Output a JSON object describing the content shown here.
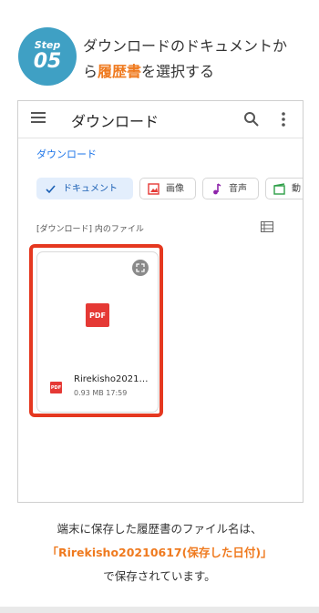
{
  "step": {
    "word": "Step",
    "number": "05"
  },
  "title": {
    "line1": "ダウンロードのドキュメントか",
    "line2_pre": "ら",
    "line2_highlight": "履歴書",
    "line2_post": "を選択する"
  },
  "appbar": {
    "title": "ダウンロード",
    "icons": [
      "menu-icon",
      "search-icon",
      "more-vert-icon"
    ]
  },
  "breadcrumb": "ダウンロード",
  "chips": [
    {
      "label": "ドキュメント",
      "icon": "check-icon",
      "active": true
    },
    {
      "label": "画像",
      "icon": "image-icon",
      "active": false
    },
    {
      "label": "音声",
      "icon": "music-note-icon",
      "active": false
    },
    {
      "label": "動",
      "icon": "video-icon",
      "active": false
    }
  ],
  "section_label": "[ダウンロード] 内のファイル",
  "file": {
    "badge": "PDF",
    "name": "Rirekisho2021…",
    "meta": "0.93 MB 17:59"
  },
  "caption": {
    "line1": "端末に保存した履歴書のファイル名は、",
    "line2": "「Rirekisho20210617(保存した日付)」",
    "line3": "で保存されています。"
  },
  "colors": {
    "badge": "#3fa0c4",
    "highlight": "#ef7a1f",
    "frame": "#e53820",
    "pdf_red": "#e53935",
    "link_blue": "#1a73e8"
  }
}
